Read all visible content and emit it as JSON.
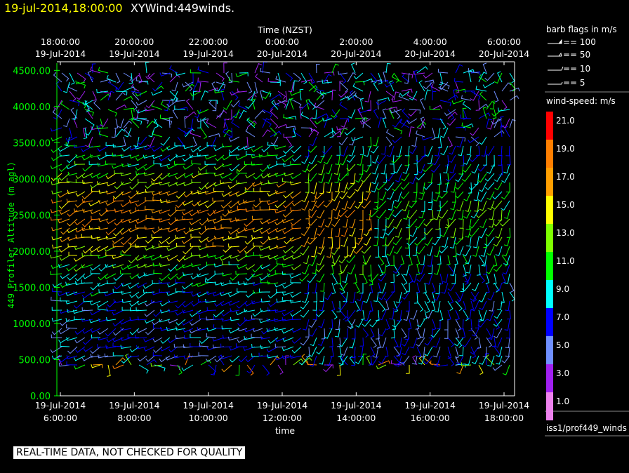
{
  "header": {
    "datetime": "19-jul-2014,18:00:00",
    "name": "XYWind:449winds."
  },
  "chart_data": {
    "type": "scatter",
    "description_kind": "wind barb time-height plot",
    "title_top_axis": "Time (NZST)",
    "xlabel": "time",
    "ylabel": "449 Profiler Altitude (m agl)",
    "ylim": [
      0,
      4600
    ],
    "y_ticks": [
      "0.00",
      "500.00",
      "1000.00",
      "1500.00",
      "2000.00",
      "2500.00",
      "3000.00",
      "3500.00",
      "4000.00",
      "4500.00"
    ],
    "x_ticks_bottom": [
      {
        "date": "19-Jul-2014",
        "time": "6:00:00"
      },
      {
        "date": "19-Jul-2014",
        "time": "8:00:00"
      },
      {
        "date": "19-Jul-2014",
        "time": "10:00:00"
      },
      {
        "date": "19-Jul-2014",
        "time": "12:00:00"
      },
      {
        "date": "19-Jul-2014",
        "time": "14:00:00"
      },
      {
        "date": "19-Jul-2014",
        "time": "16:00:00"
      },
      {
        "date": "19-Jul-2014",
        "time": "18:00:00"
      }
    ],
    "x_ticks_top": [
      {
        "time": "18:00:00",
        "date": "19-Jul-2014"
      },
      {
        "time": "20:00:00",
        "date": "19-Jul-2014"
      },
      {
        "time": "22:00:00",
        "date": "19-Jul-2014"
      },
      {
        "time": "0:00:00",
        "date": "20-Jul-2014"
      },
      {
        "time": "2:00:00",
        "date": "20-Jul-2014"
      },
      {
        "time": "4:00:00",
        "date": "20-Jul-2014"
      },
      {
        "time": "6:00:00",
        "date": "20-Jul-2014"
      }
    ],
    "grid": false
  },
  "legend": {
    "barb_title": "barb flags in m/s",
    "barb_entries": [
      "== 100",
      "== 50",
      "== 10",
      "== 5"
    ],
    "speed_title": "wind-speed: m/s",
    "speed_scale": [
      {
        "label": "21.0",
        "color": "#ff0000"
      },
      {
        "label": "19.0",
        "color": "#ff7f00"
      },
      {
        "label": "17.0",
        "color": "#ff9f00"
      },
      {
        "label": "15.0",
        "color": "#ffff00"
      },
      {
        "label": "13.0",
        "color": "#7fff00"
      },
      {
        "label": "11.0",
        "color": "#00ff00"
      },
      {
        "label": "9.0",
        "color": "#00ffff"
      },
      {
        "label": "7.0",
        "color": "#0000ff"
      },
      {
        "label": "5.0",
        "color": "#6f8fff"
      },
      {
        "label": "3.0",
        "color": "#a020f0"
      },
      {
        "label": "1.0",
        "color": "#ee82ee"
      }
    ],
    "source": "iss1/prof449_winds"
  },
  "footer": {
    "quality_note": "REAL-TIME DATA, NOT CHECKED FOR QUALITY"
  },
  "colors": {
    "axis": "#00ff00",
    "title_time": "#ffff00",
    "background": "#000000"
  }
}
